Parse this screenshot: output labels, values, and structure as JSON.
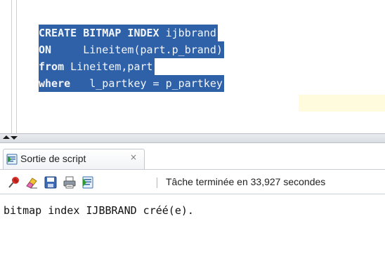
{
  "editor": {
    "lines": [
      {
        "kw": "CREATE BITMAP INDEX",
        "rest": " ijbbrand"
      },
      {
        "kw": "ON",
        "rest": "     Lineitem(part.p_brand)"
      },
      {
        "kw": "from",
        "rest": " Lineitem,part"
      },
      {
        "kw": "where",
        "rest": "   l_partkey = p_partkey"
      }
    ]
  },
  "output_panel": {
    "tab_label": "Sortie de script",
    "tab_close": "×",
    "status": "Tâche terminée en 33,927 secondes",
    "output_text": "bitmap index IJBBRAND créé(e)."
  },
  "icons": {
    "tab": "script-output-icon",
    "toolbar": [
      "pin-icon",
      "eraser-icon",
      "save-icon",
      "print-icon",
      "script-icon"
    ]
  },
  "colors": {
    "selection": "#2f61a8",
    "current_line": "#fffbdc"
  }
}
